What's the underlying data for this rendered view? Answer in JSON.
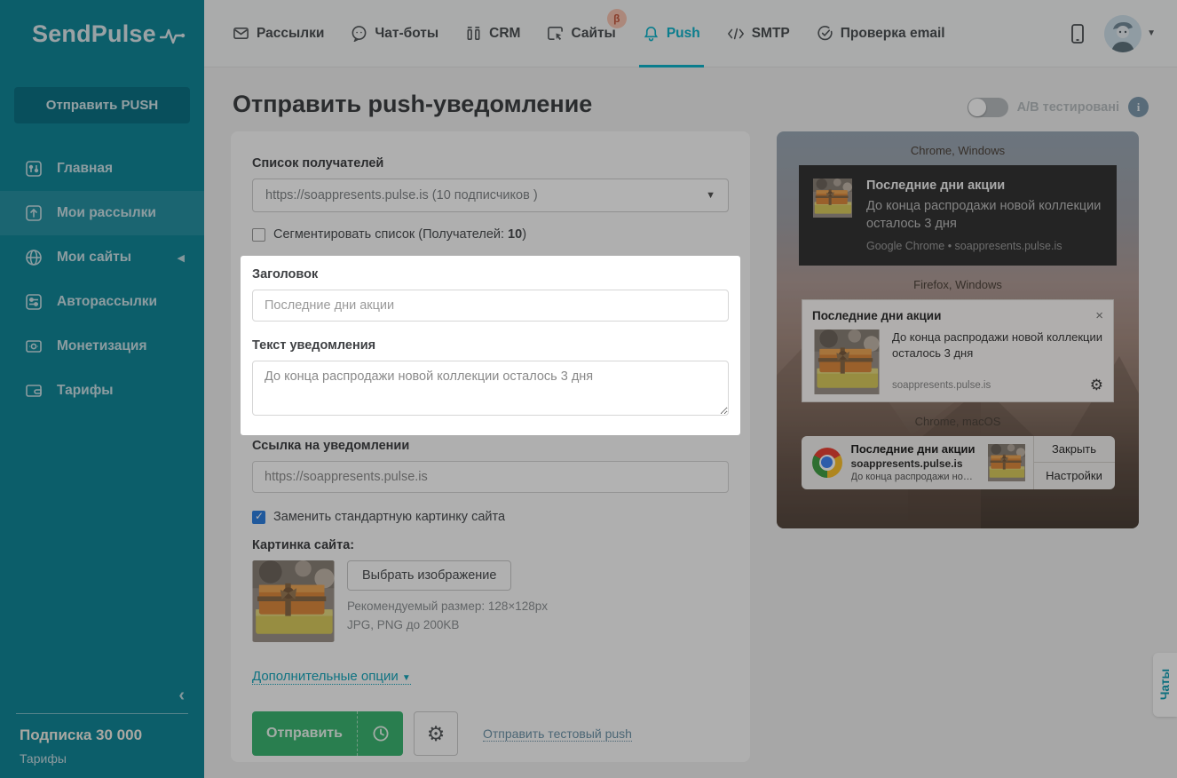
{
  "brand": {
    "logo_text": "SendPulse"
  },
  "topnav": {
    "items": [
      {
        "label": "Рассылки"
      },
      {
        "label": "Чат-боты"
      },
      {
        "label": "CRM"
      },
      {
        "label": "Сайты",
        "badge": "β"
      },
      {
        "label": "Push"
      },
      {
        "label": "SMTP"
      },
      {
        "label": "Проверка email"
      }
    ]
  },
  "sidebar": {
    "send_push_button": "Отправить PUSH",
    "items": [
      {
        "label": "Главная"
      },
      {
        "label": "Мои рассылки"
      },
      {
        "label": "Мои сайты"
      },
      {
        "label": "Авторассылки"
      },
      {
        "label": "Монетизация"
      },
      {
        "label": "Тарифы"
      }
    ],
    "subscription": "Подписка 30 000",
    "tariffs_link": "Тарифы"
  },
  "page": {
    "title": "Отправить push-уведомление",
    "ab_toggle_label": "A/B тестировані",
    "info_icon_glyph": "i"
  },
  "form": {
    "recipients_label": "Список получателей",
    "recipients_value": "https://soappresents.pulse.is (10 подписчиков )",
    "segment_pre": "Сегментировать список (Получателей: ",
    "segment_count": "10",
    "segment_post": ")",
    "title_label": "Заголовок",
    "title_value": "Последние дни акции",
    "text_label": "Текст уведомления",
    "text_value": "До конца распродажи новой коллекции осталось 3 дня",
    "link_label": "Ссылка на уведомлении",
    "link_value": "https://soappresents.pulse.is",
    "replace_image_label": "Заменить стандартную картинку сайта",
    "site_image_label": "Картинка сайта:",
    "choose_image_button": "Выбрать изображение",
    "size_hint": "Рекомендуемый размер: 128×128px",
    "format_hint": "JPG, PNG до 200KB",
    "additional_options_link": "Дополнительные опции",
    "send_button": "Отправить",
    "test_push_link": "Отправить тестовый push"
  },
  "preview": {
    "chrome_windows": {
      "os": "Chrome, Windows",
      "title": "Последние дни акции",
      "body": "До конца распродажи новой коллекции осталось 3 дня",
      "source": "Google Chrome • soappresents.pulse.is"
    },
    "firefox_windows": {
      "os": "Firefox, Windows",
      "title": "Последние дни акции",
      "body": "До конца распродажи новой коллекции осталось 3 дня",
      "domain": "soappresents.pulse.is",
      "close_glyph": "×"
    },
    "chrome_macos": {
      "os": "Chrome, macOS",
      "title": "Последние дни акции",
      "domain": "soappresents.pulse.is",
      "body": "До конца распродажи новой…",
      "close_button": "Закрыть",
      "settings_button": "Настройки"
    }
  },
  "chats_tab": "Чаты",
  "colors": {
    "accent_teal": "#0fb4cb",
    "sidebar_teal": "#128799",
    "send_green": "#3cb571",
    "checkbox_blue": "#2f80e0",
    "beta_badge_bg": "#f6c3b0",
    "overlay": "rgba(0,0,0,0.30)"
  }
}
